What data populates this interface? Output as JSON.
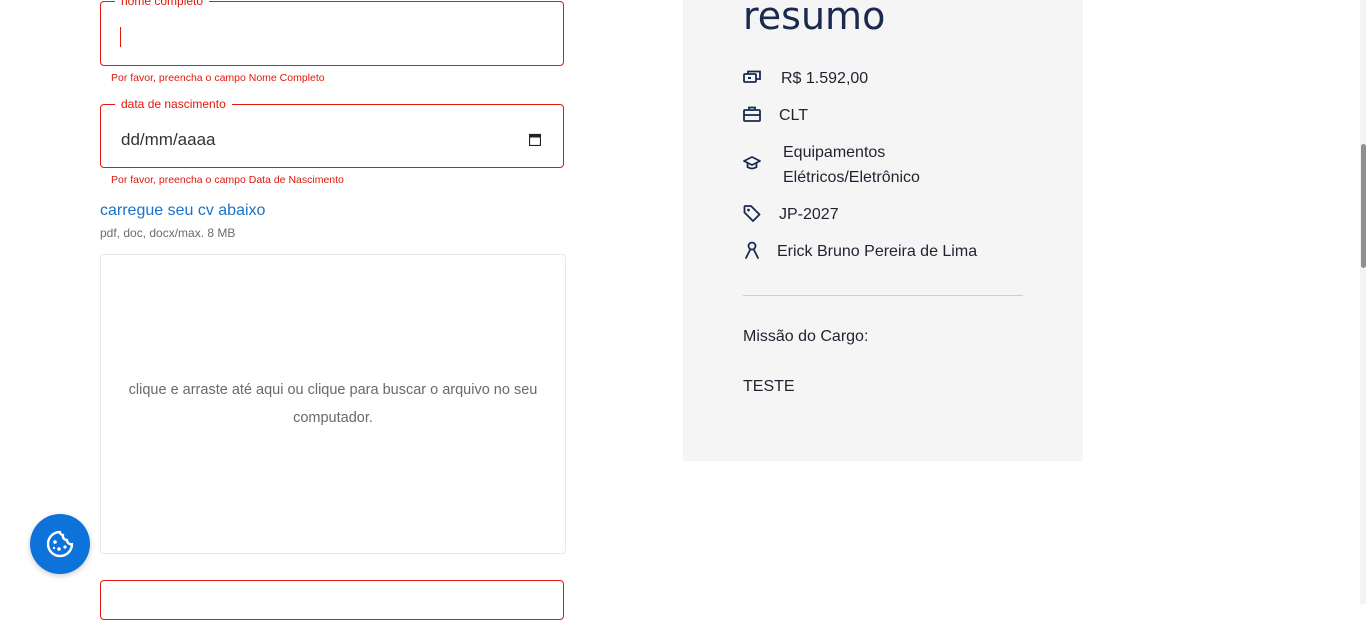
{
  "form": {
    "full_name": {
      "label": "nome completo",
      "value": "",
      "error": "Por favor, preencha o campo Nome Completo"
    },
    "birth_date": {
      "label": "data de nascimento",
      "placeholder": "dd/mm/aaaa",
      "error": "Por favor, preencha o campo Data de Nascimento"
    },
    "upload": {
      "title": "carregue seu cv abaixo",
      "hint": "pdf, doc, docx/max. 8 MB",
      "dropzone_text": "clique e arraste até aqui ou clique para buscar o arquivo no seu computador."
    }
  },
  "summary": {
    "title": "resumo",
    "items": [
      {
        "icon": "money-icon",
        "text": "R$ 1.592,00"
      },
      {
        "icon": "briefcase-icon",
        "text": "CLT"
      },
      {
        "icon": "graduation-cap-icon",
        "text": "Equipamentos Elétricos/Eletrônico"
      },
      {
        "icon": "tag-icon",
        "text": "JP-2027"
      },
      {
        "icon": "person-icon",
        "text": "Erick Bruno Pereira de Lima"
      }
    ],
    "mission_label": "Missão do Cargo:",
    "mission_text": "TESTE"
  },
  "cookie_button": {
    "icon": "cookie-icon"
  },
  "colors": {
    "error": "#e3170a",
    "link": "#1a73c9",
    "accent": "#0d72d9",
    "summary_bg": "#f5f5f5",
    "title": "#1a2a4f"
  }
}
